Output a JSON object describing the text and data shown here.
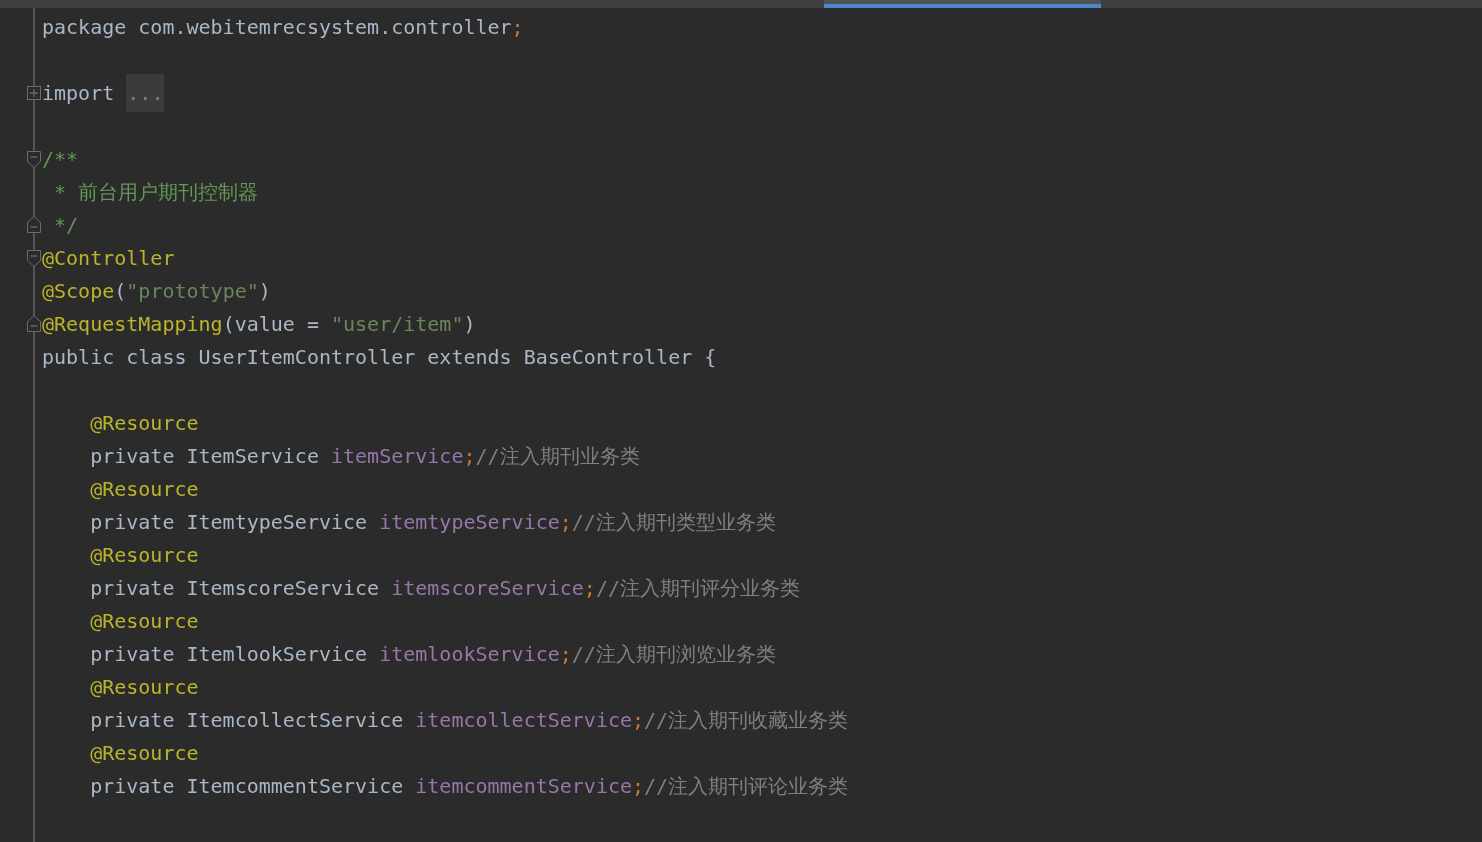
{
  "blocks": [
    {
      "lines": [
        {
          "kind": "plain",
          "tokens": [
            {
              "text": "package com.webitemrecsystem.controller",
              "kind": "plain"
            },
            {
              "text": ";",
              "kind": "punct"
            }
          ]
        }
      ]
    },
    {
      "lines": [
        {
          "kind": "collapsed",
          "tokens": [
            {
              "text": "import ",
              "kind": "plain"
            },
            {
              "text": "...",
              "kind": "folded"
            }
          ]
        }
      ]
    },
    {
      "lines": [
        {
          "kind": "fold_start",
          "tokens": [
            {
              "text": "/**",
              "kind": "doc"
            }
          ]
        },
        {
          "kind": "plain",
          "tokens": [
            {
              "text": " * 前台用户期刊控制器",
              "kind": "doc"
            }
          ]
        },
        {
          "kind": "fold_end",
          "tokens": [
            {
              "text": " */",
              "kind": "doc"
            }
          ]
        },
        {
          "kind": "fold_start",
          "tokens": [
            {
              "text": "@Controller",
              "kind": "annotation"
            }
          ]
        },
        {
          "kind": "plain",
          "tokens": [
            {
              "text": "@Scope",
              "kind": "annotation"
            },
            {
              "text": "(",
              "kind": "plain"
            },
            {
              "text": "\"prototype\"",
              "kind": "string"
            },
            {
              "text": ")",
              "kind": "plain"
            }
          ]
        },
        {
          "kind": "fold_end",
          "tokens": [
            {
              "text": "@RequestMapping",
              "kind": "annotation"
            },
            {
              "text": "(value = ",
              "kind": "plain"
            },
            {
              "text": "\"user/item\"",
              "kind": "string"
            },
            {
              "text": ")",
              "kind": "plain"
            }
          ]
        },
        {
          "kind": "plain",
          "tokens": [
            {
              "text": "public class UserItemController extends BaseController {",
              "kind": "plain"
            }
          ]
        }
      ]
    },
    {
      "lines": [
        {
          "kind": "plain",
          "tokens": [
            {
              "text": "    @Resource",
              "kind": "annotation"
            }
          ]
        },
        {
          "kind": "plain",
          "tokens": [
            {
              "text": "    private ItemService ",
              "kind": "plain"
            },
            {
              "text": "itemService",
              "kind": "field"
            },
            {
              "text": ";",
              "kind": "punct"
            },
            {
              "text": "//注入期刊业务类",
              "kind": "comment"
            }
          ]
        },
        {
          "kind": "plain",
          "tokens": [
            {
              "text": "    @Resource",
              "kind": "annotation"
            }
          ]
        },
        {
          "kind": "plain",
          "tokens": [
            {
              "text": "    private ItemtypeService ",
              "kind": "plain"
            },
            {
              "text": "itemtypeService",
              "kind": "field"
            },
            {
              "text": ";",
              "kind": "punct"
            },
            {
              "text": "//注入期刊类型业务类",
              "kind": "comment"
            }
          ]
        },
        {
          "kind": "plain",
          "tokens": [
            {
              "text": "    @Resource",
              "kind": "annotation"
            }
          ]
        },
        {
          "kind": "plain",
          "tokens": [
            {
              "text": "    private ItemscoreService ",
              "kind": "plain"
            },
            {
              "text": "itemscoreService",
              "kind": "field"
            },
            {
              "text": ";",
              "kind": "punct"
            },
            {
              "text": "//注入期刊评分业务类",
              "kind": "comment"
            }
          ]
        },
        {
          "kind": "plain",
          "tokens": [
            {
              "text": "    @Resource",
              "kind": "annotation"
            }
          ]
        },
        {
          "kind": "plain",
          "tokens": [
            {
              "text": "    private ItemlookService ",
              "kind": "plain"
            },
            {
              "text": "itemlookService",
              "kind": "field"
            },
            {
              "text": ";",
              "kind": "punct"
            },
            {
              "text": "//注入期刊浏览业务类",
              "kind": "comment"
            }
          ]
        },
        {
          "kind": "plain",
          "tokens": [
            {
              "text": "    @Resource",
              "kind": "annotation"
            }
          ]
        },
        {
          "kind": "plain",
          "tokens": [
            {
              "text": "    private ItemcollectService ",
              "kind": "plain"
            },
            {
              "text": "itemcollectService",
              "kind": "field"
            },
            {
              "text": ";",
              "kind": "punct"
            },
            {
              "text": "//注入期刊收藏业务类",
              "kind": "comment"
            }
          ]
        },
        {
          "kind": "plain",
          "tokens": [
            {
              "text": "    @Resource",
              "kind": "annotation"
            }
          ]
        },
        {
          "kind": "plain",
          "tokens": [
            {
              "text": "    private ItemcommentService ",
              "kind": "plain"
            },
            {
              "text": "itemcommentService",
              "kind": "field"
            },
            {
              "text": ";",
              "kind": "punct"
            },
            {
              "text": "//注入期刊评论业务类",
              "kind": "comment"
            }
          ]
        }
      ]
    }
  ]
}
